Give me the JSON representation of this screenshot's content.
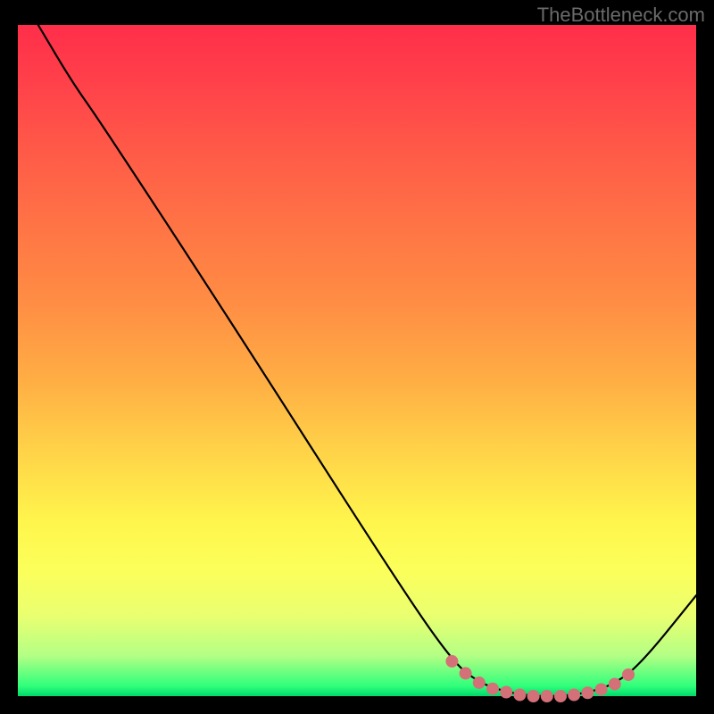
{
  "attribution": "TheBottleneck.com",
  "chart_data": {
    "type": "line",
    "title": "",
    "xlabel": "",
    "ylabel": "",
    "xlim": [
      0,
      100
    ],
    "ylim": [
      0,
      100
    ],
    "series": [
      {
        "name": "bottleneck-curve",
        "points": [
          {
            "x": 3.0,
            "y": 100.0
          },
          {
            "x": 8.0,
            "y": 91.5
          },
          {
            "x": 12.0,
            "y": 85.8
          },
          {
            "x": 30.0,
            "y": 58.0
          },
          {
            "x": 55.0,
            "y": 18.5
          },
          {
            "x": 64.0,
            "y": 5.2
          },
          {
            "x": 68.0,
            "y": 2.0
          },
          {
            "x": 72.0,
            "y": 0.6
          },
          {
            "x": 76.0,
            "y": 0.0
          },
          {
            "x": 80.0,
            "y": 0.0
          },
          {
            "x": 84.0,
            "y": 0.5
          },
          {
            "x": 88.0,
            "y": 1.8
          },
          {
            "x": 92.0,
            "y": 5.0
          },
          {
            "x": 100.0,
            "y": 15.0
          }
        ]
      },
      {
        "name": "highlight-dots",
        "points": [
          {
            "x": 64.0,
            "y": 5.2
          },
          {
            "x": 66.0,
            "y": 3.4
          },
          {
            "x": 68.0,
            "y": 2.0
          },
          {
            "x": 70.0,
            "y": 1.1
          },
          {
            "x": 72.0,
            "y": 0.6
          },
          {
            "x": 74.0,
            "y": 0.2
          },
          {
            "x": 76.0,
            "y": 0.0
          },
          {
            "x": 78.0,
            "y": 0.0
          },
          {
            "x": 80.0,
            "y": 0.0
          },
          {
            "x": 82.0,
            "y": 0.2
          },
          {
            "x": 84.0,
            "y": 0.5
          },
          {
            "x": 86.0,
            "y": 1.0
          },
          {
            "x": 88.0,
            "y": 1.8
          },
          {
            "x": 90.0,
            "y": 3.2
          }
        ]
      }
    ],
    "colors": {
      "curve": "#000000",
      "dots": "#d47077",
      "gradient_top": "#ff2e4a",
      "gradient_bottom": "#00d96b"
    }
  }
}
